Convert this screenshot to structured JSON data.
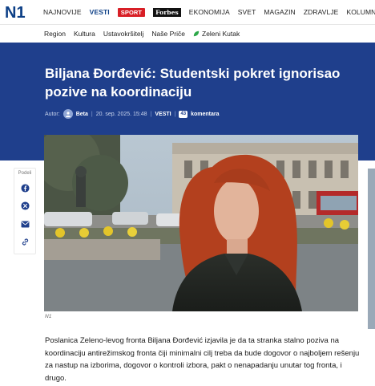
{
  "brand": {
    "logo_text": "N1"
  },
  "topnav": {
    "items": [
      "NAJNOVIJE",
      "VESTI",
      "SPORT",
      "Forbes",
      "EKONOMIJA",
      "SVET",
      "MAGAZIN",
      "ZDRAVLJE",
      "KOLUMNE"
    ]
  },
  "subnav": {
    "items": [
      "Region",
      "Kultura",
      "Ustavokršitelj",
      "Naše Priče",
      "Zeleni Kutak"
    ]
  },
  "article": {
    "title": "Biljana Đorđević: Studentski pokret ignorisao pozive na koordinaciju",
    "author_label": "Autor:",
    "author": "Beta",
    "date": "20. sep. 2025. 15:48",
    "section": "VESTI",
    "comment_count": "43",
    "comments_label": "komentara",
    "photo_credit": "N1",
    "paragraph": "Poslanica Zeleno-levog fronta Biljana Đorđević izjavila je da ta stranka stalno poziva na koordinaciju antirežimskog fronta čiji minimalni cilj treba da bude dogovor o najboljem rešenju za nastup na izborima, dogovor o kontroli izbora, pakt o nenapadanju unutar tog fronta, i drugo."
  },
  "share": {
    "label": "Podeli",
    "buttons": [
      "facebook-icon",
      "x-icon",
      "mail-icon",
      "link-icon"
    ]
  },
  "colors": {
    "hero_bg": "#1f3f8c",
    "active_nav": "#0c3f86",
    "sport_badge": "#d81f26"
  }
}
